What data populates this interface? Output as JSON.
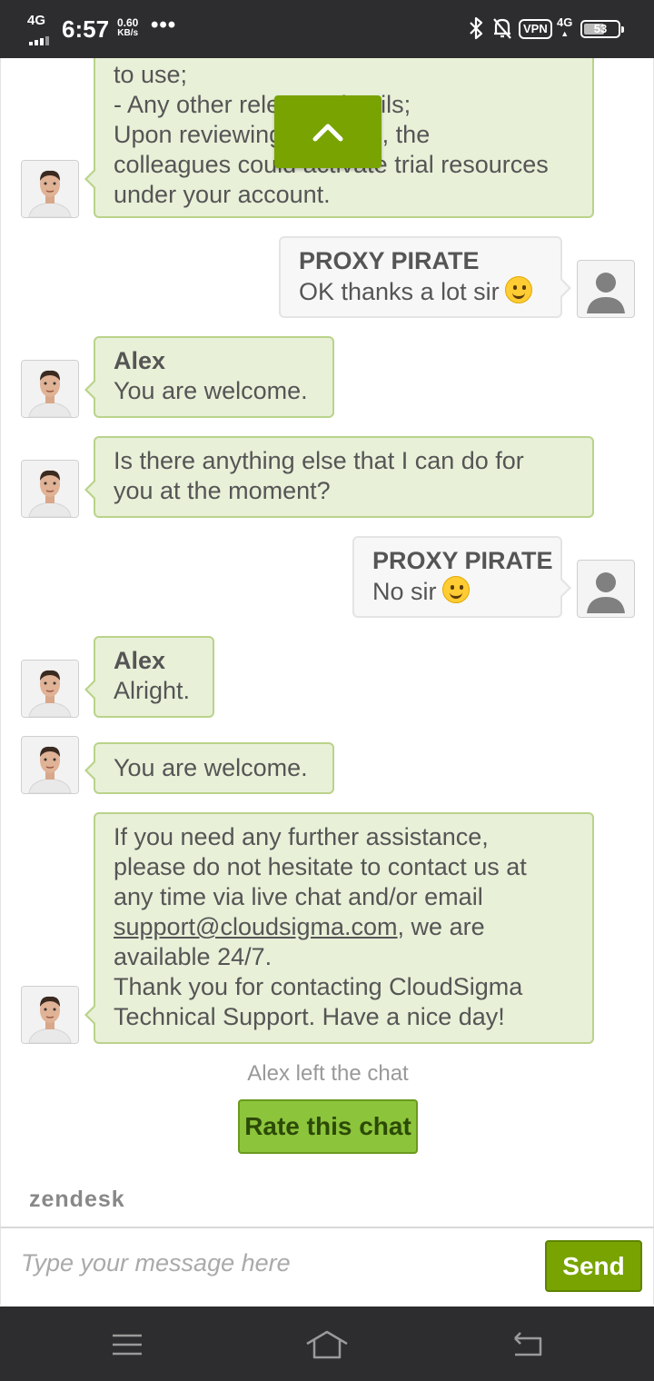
{
  "status_bar": {
    "network": "4G",
    "time": "6:57",
    "speed_value": "0.60",
    "speed_unit": "KB/s",
    "more": "•••",
    "vpn": "VPN",
    "network_right": "4G",
    "battery": "53"
  },
  "chat": {
    "messages": [
      {
        "lines": [
          "to use;",
          "- Any other relevant details;",
          "Upon reviewing the case, the",
          "colleagues could activate trial resources",
          "under your account."
        ]
      },
      {
        "sender": "PROXY PIRATE",
        "text": "OK thanks a lot sir"
      },
      {
        "sender": "Alex",
        "text": "You are welcome."
      },
      {
        "lines": [
          "Is there anything else that I can do for",
          "you at the moment?"
        ]
      },
      {
        "sender": "PROXY PIRATE",
        "text": "No sir"
      },
      {
        "sender": "Alex",
        "text": "Alright."
      },
      {
        "text": "You are welcome."
      },
      {
        "lines": [
          "If you need any further assistance,",
          "please do not hesitate to contact us at",
          "any time via live chat and/or email"
        ],
        "email": "support@cloudsigma.com",
        "after_email": ", we are",
        "lines2": [
          "available 24/7.",
          "Thank you for contacting CloudSigma",
          "Technical Support. Have a nice day!"
        ]
      }
    ],
    "left_note": "Alex left the chat",
    "rate_label": "Rate this chat",
    "brand": "zendesk"
  },
  "input": {
    "placeholder": "Type your message here",
    "value": "",
    "send_label": "Send"
  },
  "colors": {
    "agent_bubble": "#e8f0d8",
    "agent_border": "#b9d38a",
    "accent_green": "#78a300",
    "system_bar": "#2d2d2f"
  },
  "icons": [
    "scroll-to-top-icon",
    "bluetooth-icon",
    "mute-icon",
    "menu-icon",
    "home-icon",
    "back-icon",
    "smile-emoji-icon",
    "user-avatar-icon",
    "agent-avatar"
  ]
}
